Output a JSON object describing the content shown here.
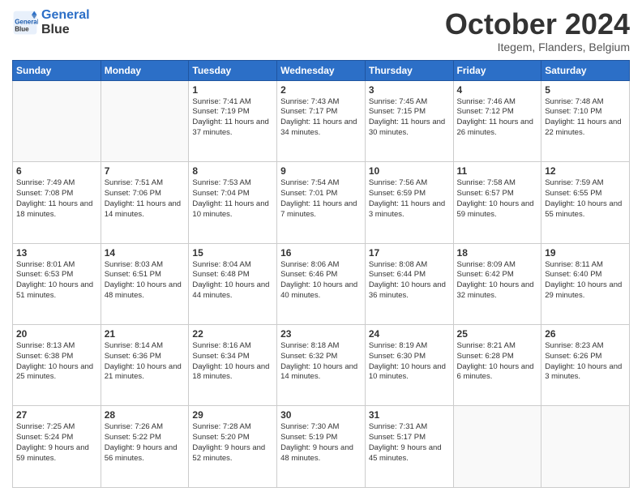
{
  "header": {
    "logo_line1": "General",
    "logo_line2": "Blue",
    "month": "October 2024",
    "location": "Itegem, Flanders, Belgium"
  },
  "days_of_week": [
    "Sunday",
    "Monday",
    "Tuesday",
    "Wednesday",
    "Thursday",
    "Friday",
    "Saturday"
  ],
  "weeks": [
    [
      {
        "day": "",
        "sunrise": "",
        "sunset": "",
        "daylight": "",
        "empty": true
      },
      {
        "day": "",
        "sunrise": "",
        "sunset": "",
        "daylight": "",
        "empty": true
      },
      {
        "day": "1",
        "sunrise": "Sunrise: 7:41 AM",
        "sunset": "Sunset: 7:19 PM",
        "daylight": "Daylight: 11 hours and 37 minutes."
      },
      {
        "day": "2",
        "sunrise": "Sunrise: 7:43 AM",
        "sunset": "Sunset: 7:17 PM",
        "daylight": "Daylight: 11 hours and 34 minutes."
      },
      {
        "day": "3",
        "sunrise": "Sunrise: 7:45 AM",
        "sunset": "Sunset: 7:15 PM",
        "daylight": "Daylight: 11 hours and 30 minutes."
      },
      {
        "day": "4",
        "sunrise": "Sunrise: 7:46 AM",
        "sunset": "Sunset: 7:12 PM",
        "daylight": "Daylight: 11 hours and 26 minutes."
      },
      {
        "day": "5",
        "sunrise": "Sunrise: 7:48 AM",
        "sunset": "Sunset: 7:10 PM",
        "daylight": "Daylight: 11 hours and 22 minutes."
      }
    ],
    [
      {
        "day": "6",
        "sunrise": "Sunrise: 7:49 AM",
        "sunset": "Sunset: 7:08 PM",
        "daylight": "Daylight: 11 hours and 18 minutes."
      },
      {
        "day": "7",
        "sunrise": "Sunrise: 7:51 AM",
        "sunset": "Sunset: 7:06 PM",
        "daylight": "Daylight: 11 hours and 14 minutes."
      },
      {
        "day": "8",
        "sunrise": "Sunrise: 7:53 AM",
        "sunset": "Sunset: 7:04 PM",
        "daylight": "Daylight: 11 hours and 10 minutes."
      },
      {
        "day": "9",
        "sunrise": "Sunrise: 7:54 AM",
        "sunset": "Sunset: 7:01 PM",
        "daylight": "Daylight: 11 hours and 7 minutes."
      },
      {
        "day": "10",
        "sunrise": "Sunrise: 7:56 AM",
        "sunset": "Sunset: 6:59 PM",
        "daylight": "Daylight: 11 hours and 3 minutes."
      },
      {
        "day": "11",
        "sunrise": "Sunrise: 7:58 AM",
        "sunset": "Sunset: 6:57 PM",
        "daylight": "Daylight: 10 hours and 59 minutes."
      },
      {
        "day": "12",
        "sunrise": "Sunrise: 7:59 AM",
        "sunset": "Sunset: 6:55 PM",
        "daylight": "Daylight: 10 hours and 55 minutes."
      }
    ],
    [
      {
        "day": "13",
        "sunrise": "Sunrise: 8:01 AM",
        "sunset": "Sunset: 6:53 PM",
        "daylight": "Daylight: 10 hours and 51 minutes."
      },
      {
        "day": "14",
        "sunrise": "Sunrise: 8:03 AM",
        "sunset": "Sunset: 6:51 PM",
        "daylight": "Daylight: 10 hours and 48 minutes."
      },
      {
        "day": "15",
        "sunrise": "Sunrise: 8:04 AM",
        "sunset": "Sunset: 6:48 PM",
        "daylight": "Daylight: 10 hours and 44 minutes."
      },
      {
        "day": "16",
        "sunrise": "Sunrise: 8:06 AM",
        "sunset": "Sunset: 6:46 PM",
        "daylight": "Daylight: 10 hours and 40 minutes."
      },
      {
        "day": "17",
        "sunrise": "Sunrise: 8:08 AM",
        "sunset": "Sunset: 6:44 PM",
        "daylight": "Daylight: 10 hours and 36 minutes."
      },
      {
        "day": "18",
        "sunrise": "Sunrise: 8:09 AM",
        "sunset": "Sunset: 6:42 PM",
        "daylight": "Daylight: 10 hours and 32 minutes."
      },
      {
        "day": "19",
        "sunrise": "Sunrise: 8:11 AM",
        "sunset": "Sunset: 6:40 PM",
        "daylight": "Daylight: 10 hours and 29 minutes."
      }
    ],
    [
      {
        "day": "20",
        "sunrise": "Sunrise: 8:13 AM",
        "sunset": "Sunset: 6:38 PM",
        "daylight": "Daylight: 10 hours and 25 minutes."
      },
      {
        "day": "21",
        "sunrise": "Sunrise: 8:14 AM",
        "sunset": "Sunset: 6:36 PM",
        "daylight": "Daylight: 10 hours and 21 minutes."
      },
      {
        "day": "22",
        "sunrise": "Sunrise: 8:16 AM",
        "sunset": "Sunset: 6:34 PM",
        "daylight": "Daylight: 10 hours and 18 minutes."
      },
      {
        "day": "23",
        "sunrise": "Sunrise: 8:18 AM",
        "sunset": "Sunset: 6:32 PM",
        "daylight": "Daylight: 10 hours and 14 minutes."
      },
      {
        "day": "24",
        "sunrise": "Sunrise: 8:19 AM",
        "sunset": "Sunset: 6:30 PM",
        "daylight": "Daylight: 10 hours and 10 minutes."
      },
      {
        "day": "25",
        "sunrise": "Sunrise: 8:21 AM",
        "sunset": "Sunset: 6:28 PM",
        "daylight": "Daylight: 10 hours and 6 minutes."
      },
      {
        "day": "26",
        "sunrise": "Sunrise: 8:23 AM",
        "sunset": "Sunset: 6:26 PM",
        "daylight": "Daylight: 10 hours and 3 minutes."
      }
    ],
    [
      {
        "day": "27",
        "sunrise": "Sunrise: 7:25 AM",
        "sunset": "Sunset: 5:24 PM",
        "daylight": "Daylight: 9 hours and 59 minutes."
      },
      {
        "day": "28",
        "sunrise": "Sunrise: 7:26 AM",
        "sunset": "Sunset: 5:22 PM",
        "daylight": "Daylight: 9 hours and 56 minutes."
      },
      {
        "day": "29",
        "sunrise": "Sunrise: 7:28 AM",
        "sunset": "Sunset: 5:20 PM",
        "daylight": "Daylight: 9 hours and 52 minutes."
      },
      {
        "day": "30",
        "sunrise": "Sunrise: 7:30 AM",
        "sunset": "Sunset: 5:19 PM",
        "daylight": "Daylight: 9 hours and 48 minutes."
      },
      {
        "day": "31",
        "sunrise": "Sunrise: 7:31 AM",
        "sunset": "Sunset: 5:17 PM",
        "daylight": "Daylight: 9 hours and 45 minutes."
      },
      {
        "day": "",
        "sunrise": "",
        "sunset": "",
        "daylight": "",
        "empty": true
      },
      {
        "day": "",
        "sunrise": "",
        "sunset": "",
        "daylight": "",
        "empty": true
      }
    ]
  ]
}
